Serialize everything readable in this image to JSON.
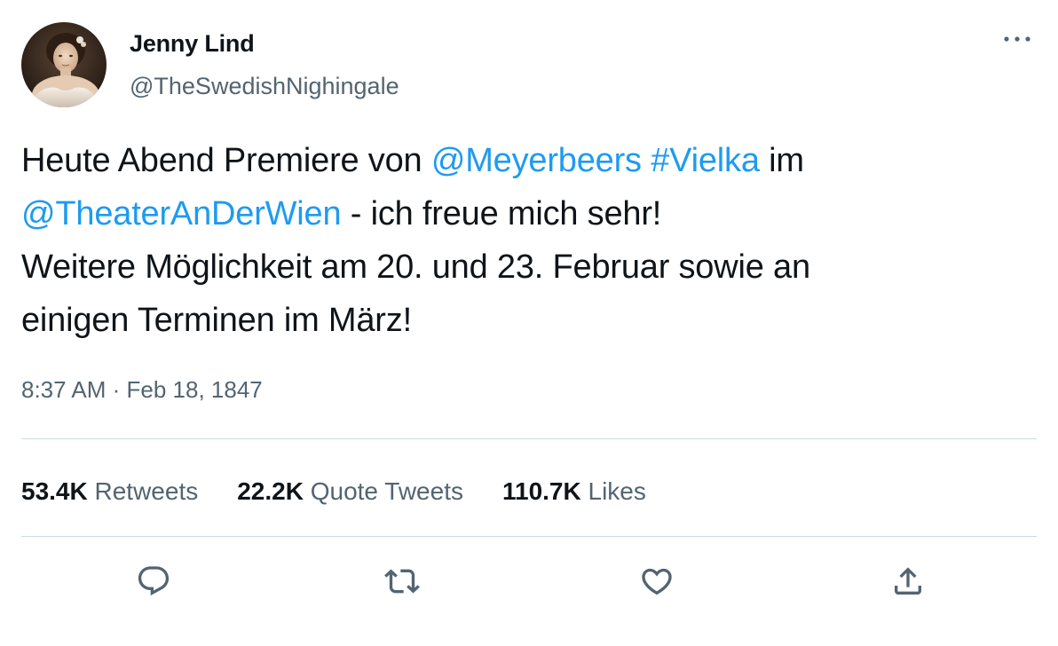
{
  "author": {
    "name": "Jenny Lind",
    "handle": "@TheSwedishNighingale"
  },
  "tweet": {
    "line1": {
      "text_a": "Heute Abend Premiere von ",
      "mention_1": "@Meyerbeers",
      "space": " ",
      "hashtag": "#Vielka",
      "text_b": " im"
    },
    "line2": {
      "mention_2": "@TheaterAnDerWien",
      "text": " - ich freue mich sehr!"
    },
    "line3": "Weitere Möglichkeit am 20. und 23. Februar sowie an",
    "line4": "einigen Terminen im März!"
  },
  "meta": {
    "time": "8:37 AM",
    "separator": " · ",
    "date": "Feb 18, 1847"
  },
  "stats": {
    "retweets": {
      "count": "53.4K",
      "label": "Retweets"
    },
    "quotes": {
      "count": "22.2K",
      "label": "Quote Tweets"
    },
    "likes": {
      "count": "110.7K",
      "label": "Likes"
    }
  },
  "actions": {
    "reply_icon": "reply-icon",
    "retweet_icon": "retweet-icon",
    "like_icon": "heart-icon",
    "share_icon": "share-icon"
  },
  "colors": {
    "link": "#1d9bf0",
    "text": "#0f1419",
    "secondary": "#536471",
    "divider": "#cfd9de"
  }
}
